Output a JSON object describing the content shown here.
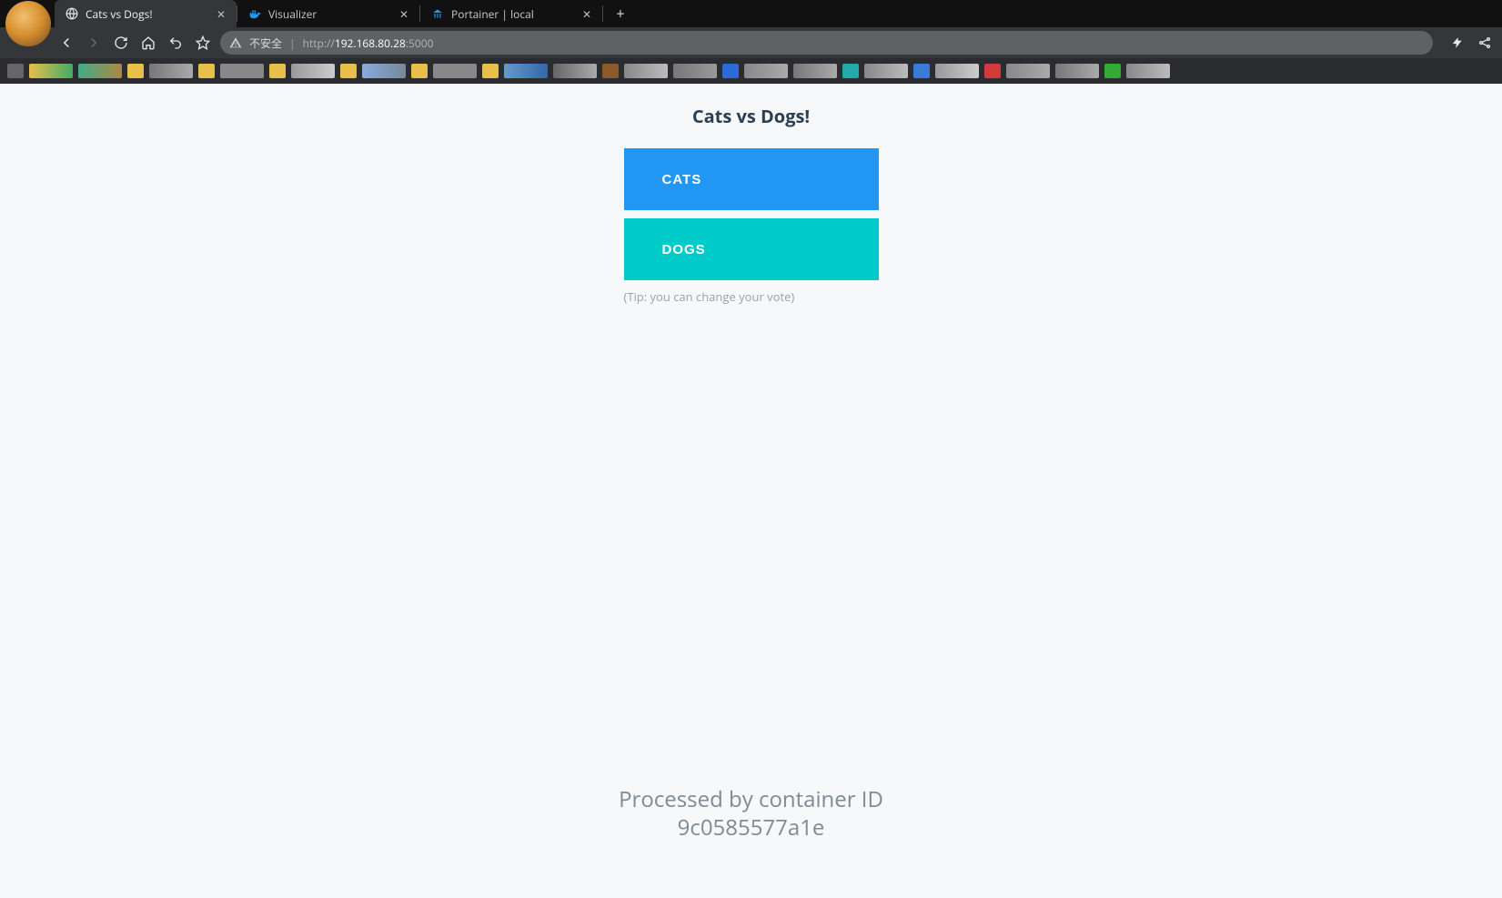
{
  "browser": {
    "tabs": [
      {
        "title": "Cats vs Dogs!",
        "favicon": "globe-icon",
        "active": true
      },
      {
        "title": "Visualizer",
        "favicon": "whale-icon",
        "active": false
      },
      {
        "title": "Portainer | local",
        "favicon": "portainer-icon",
        "active": false
      }
    ],
    "address": {
      "security_label": "不安全",
      "scheme": "http://",
      "host": "192.168.80.28",
      "port": ":5000"
    }
  },
  "page": {
    "title": "Cats vs Dogs!",
    "buttons": {
      "cats": "CATS",
      "dogs": "DOGS"
    },
    "tip": "(Tip: you can change your vote)",
    "footer_line1": "Processed by container ID",
    "footer_line2": "9c0585577a1e"
  }
}
